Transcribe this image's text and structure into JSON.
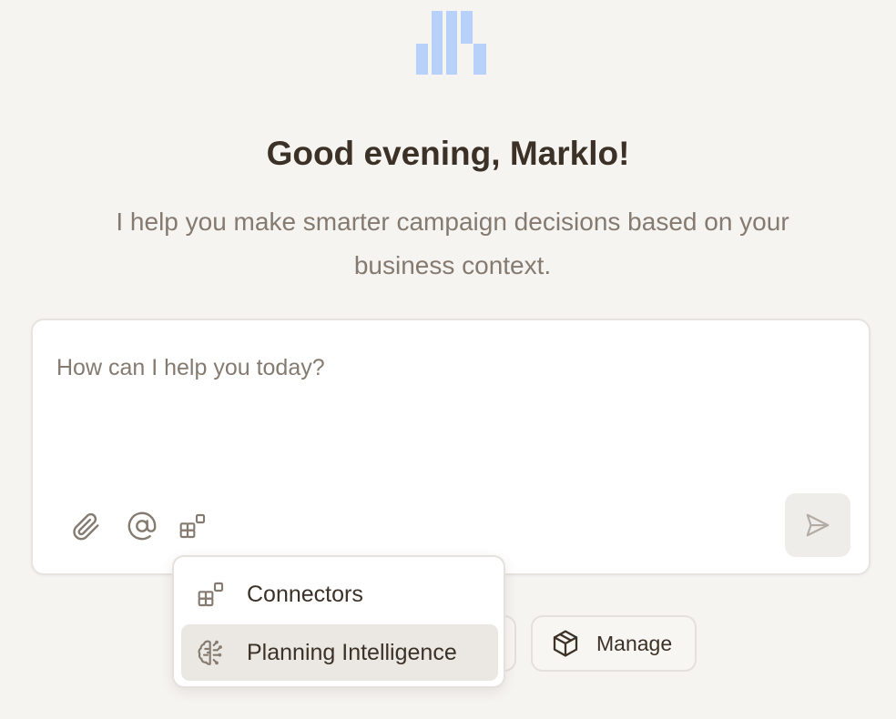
{
  "hero": {
    "greeting": "Good evening, Marklo!",
    "subtitle": "I help you make smarter campaign decisions based on your business context."
  },
  "composer": {
    "placeholder": "How can I help you today?"
  },
  "quick_actions": {
    "manage_label": "Manage"
  },
  "menu": {
    "items": [
      {
        "label": "Connectors",
        "icon": "connectors-icon"
      },
      {
        "label": "Planning Intelligence",
        "icon": "brain-icon",
        "active": true
      }
    ]
  },
  "colors": {
    "background": "#f6f4f1",
    "text_primary": "#3c3127",
    "text_secondary": "#857a70",
    "logo_blue": "#b7d1fb",
    "menu_active": "#ebe8e4"
  }
}
